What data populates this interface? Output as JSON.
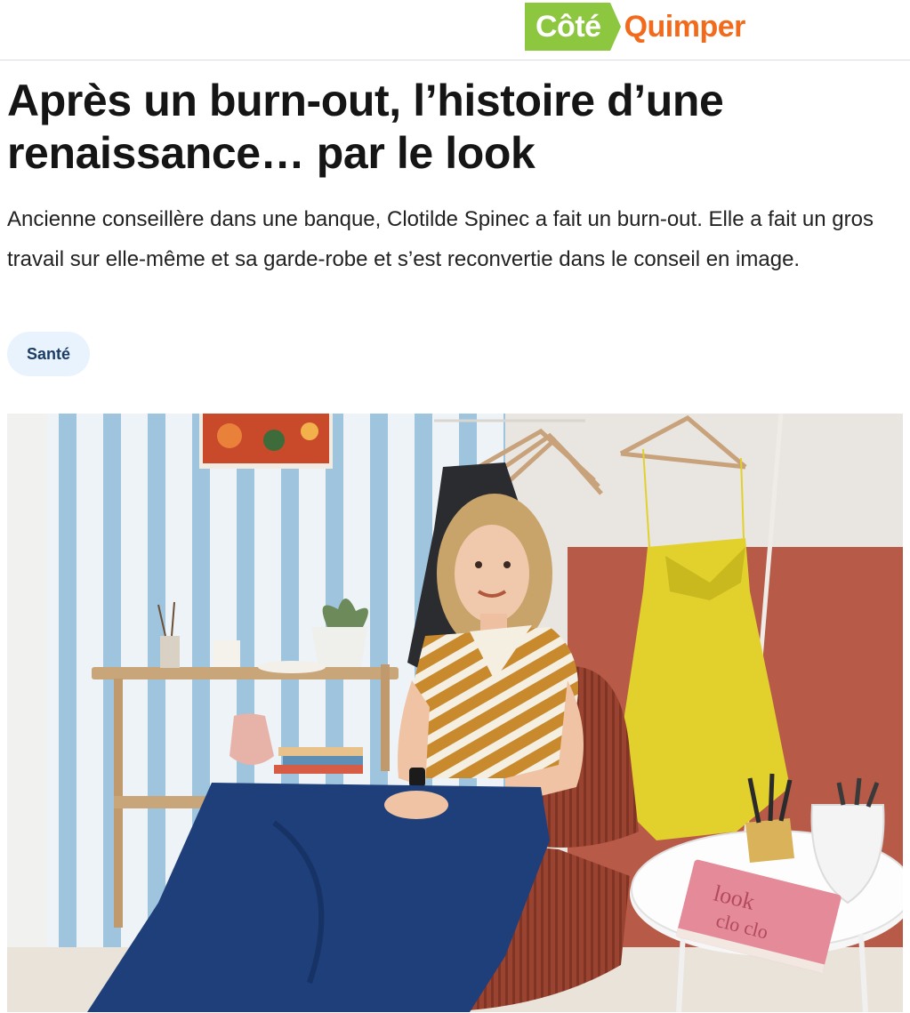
{
  "header": {
    "logo_part1": "Côté",
    "logo_part2": "Quimper",
    "logo_colors": {
      "part1_bg": "#8dc63f",
      "part2_text": "#f26a1b"
    }
  },
  "article": {
    "title": "Après un burn-out, l’histoire d’une renaissance… par le look",
    "lede": "Ancienne conseillère dans une banque, Clotilde Spinec a fait un burn-out. Elle a fait un gros travail sur elle-même et sa garde-robe et s’est reconvertie dans le conseil en image.",
    "tag": "Santé",
    "book_cover_text": "look clo clo"
  }
}
